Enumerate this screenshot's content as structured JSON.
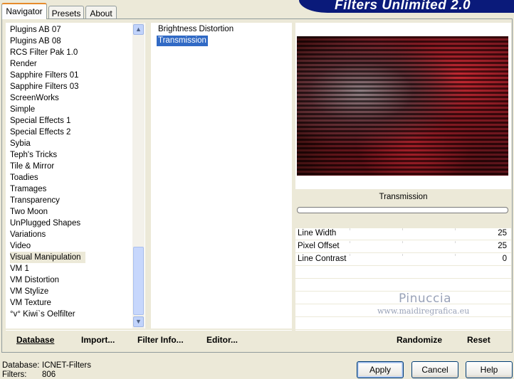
{
  "tabs": [
    {
      "label": "Navigator",
      "active": true
    },
    {
      "label": "Presets",
      "active": false
    },
    {
      "label": "About",
      "active": false
    }
  ],
  "banner_title": "Filters Unlimited 2.0",
  "categories": [
    "Plugins AB 07",
    "Plugins AB 08",
    "RCS Filter Pak 1.0",
    "Render",
    "Sapphire Filters 01",
    "Sapphire Filters 03",
    "ScreenWorks",
    "Simple",
    "Special Effects 1",
    "Special Effects 2",
    "Sybia",
    "Teph's Tricks",
    "Tile & Mirror",
    "Toadies",
    "Tramages",
    "Transparency",
    "Two Moon",
    "UnPlugged Shapes",
    "Variations",
    "Video",
    "Visual Manipulation",
    "VM 1",
    "VM Distortion",
    "VM Stylize",
    "VM Texture",
    "°v° Kiwi`s Oelfilter"
  ],
  "selected_category": "Visual Manipulation",
  "filters": [
    "Brightness Distortion",
    "Transmission"
  ],
  "selected_filter": "Transmission",
  "filter_name": "Transmission",
  "params": [
    {
      "label": "Line Width",
      "value": "25"
    },
    {
      "label": "Pixel Offset",
      "value": "25"
    },
    {
      "label": "Line Contrast",
      "value": "0"
    }
  ],
  "watermark": {
    "name": "Pinuccia",
    "url": "www.maidiregrafica.eu"
  },
  "left_buttons": {
    "database": "Database",
    "import": "Import...",
    "filter_info": "Filter Info...",
    "editor": "Editor..."
  },
  "right_buttons": {
    "randomize": "Randomize",
    "reset": "Reset"
  },
  "status": {
    "database_label": "Database:",
    "database_value": "ICNET-Filters",
    "filters_label": "Filters:",
    "filters_value": "806"
  },
  "dialog_buttons": {
    "apply": "Apply",
    "cancel": "Cancel",
    "help": "Help"
  },
  "colors": {
    "selection": "#316ac5",
    "banner": "#0a1a7a",
    "dialog_bg": "#ece9d8"
  }
}
